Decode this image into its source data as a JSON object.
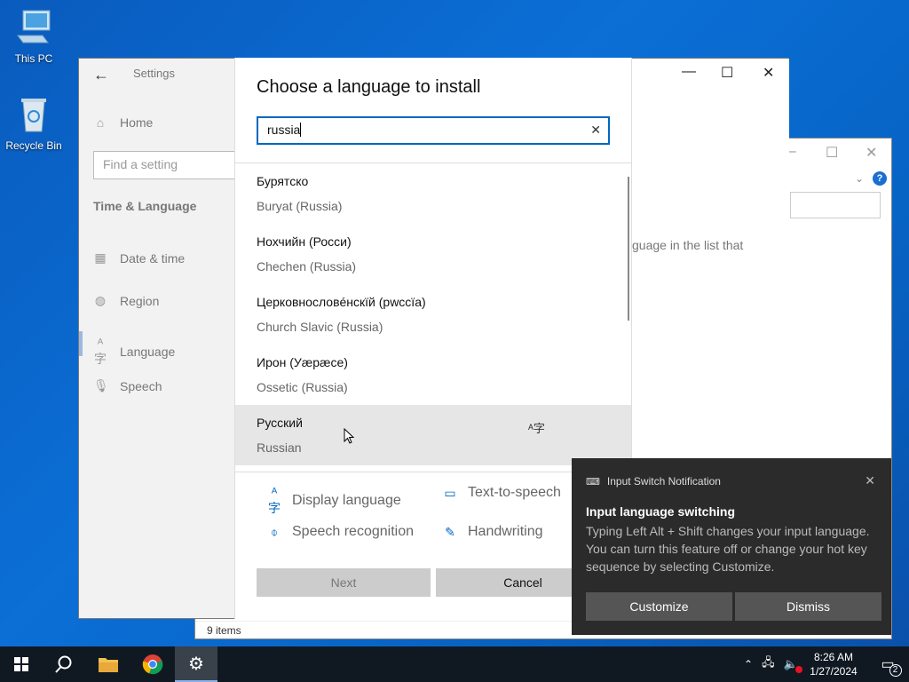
{
  "desktop": {
    "icons": [
      {
        "label": "This PC"
      },
      {
        "label": "Recycle Bin"
      }
    ]
  },
  "explorer": {
    "status": "9 items"
  },
  "settings": {
    "app_title": "Settings",
    "home": "Home",
    "search_placeholder": "Find a setting",
    "section": "Time & Language",
    "nav": [
      {
        "label": "Date & time",
        "icon": "calendar-icon"
      },
      {
        "label": "Region",
        "icon": "globe-icon"
      },
      {
        "label": "Language",
        "icon": "language-icon"
      },
      {
        "label": "Speech",
        "icon": "microphone-icon"
      }
    ],
    "hint_fragment": "guage in the list that"
  },
  "dialog": {
    "title": "Choose a language to install",
    "search_value": "russia",
    "languages": [
      {
        "native": "Бурятско",
        "english": "Buryat (Russia)"
      },
      {
        "native": "Нохчийн (Росси)",
        "english": "Chechen (Russia)"
      },
      {
        "native": "Церковнословéнскïй (рwссïа)",
        "english": "Church Slavic (Russia)"
      },
      {
        "native": "Ирон (Уæрæсе)",
        "english": "Ossetic (Russia)"
      },
      {
        "native": "Русский",
        "english": "Russian"
      }
    ],
    "selected_index": 4,
    "features": {
      "display_language": "Display language",
      "text_to_speech": "Text-to-speech",
      "speech_recognition": "Speech recognition",
      "handwriting": "Handwriting"
    },
    "next_label": "Next",
    "cancel_label": "Cancel"
  },
  "toast": {
    "app": "Input Switch Notification",
    "title": "Input language switching",
    "body": "Typing Left Alt + Shift changes your input language. You can turn this feature off or change your hot key sequence by selecting Customize.",
    "customize": "Customize",
    "dismiss": "Dismiss"
  },
  "taskbar": {
    "time": "8:26 AM",
    "date": "1/27/2024",
    "notification_count": "2"
  }
}
